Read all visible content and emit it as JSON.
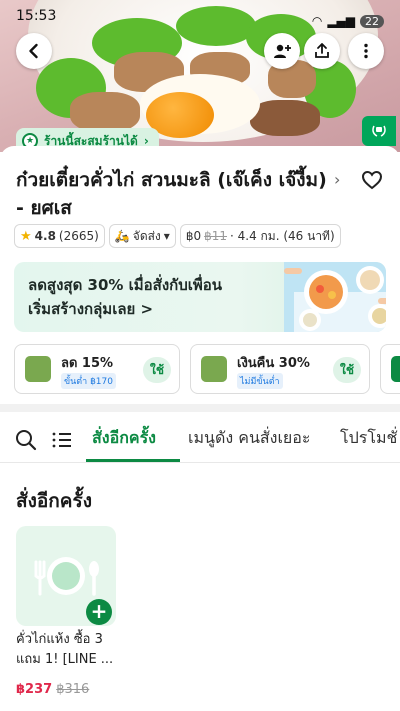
{
  "status_bar": {
    "time": "15:53",
    "battery": "22"
  },
  "hero": {
    "collect_label": "ร้านนี้สะสมร้านได้",
    "collect_chevron": "›"
  },
  "restaurant": {
    "name": "ก๋วยเตี๋ยวคั่วไก่ สวนมะลิ (เจ๊เค็ง เจ๊งี้ม) - ยศเส",
    "rating": "4.8",
    "review_count": "(2665)",
    "delivery_mode": "จัดส่ง",
    "delivery_fee": "฿0",
    "delivery_fee_original": "฿11",
    "distance_time": "· 4.4 กม. (46 นาที)"
  },
  "promo_banner": {
    "line1": "ลดสูงสุด 30% เมื่อสั่งกับเพื่อน",
    "line2": "เริ่มสร้างกลุ่มเลย >"
  },
  "coupons": [
    {
      "title": "ลด 15%",
      "sub": "ขั้นต่ำ ฿170",
      "action": "ใช้"
    },
    {
      "title": "เงินคืน 30%",
      "sub": "ไม่มีขั้นต่ำ",
      "action": "ใช้"
    }
  ],
  "tabs": {
    "active": "สั่งอีกครั้ง",
    "t2": "เมนูดัง คนสั่งเยอะ",
    "t3": "โปรโมชั่"
  },
  "section": {
    "title": "สั่งอีกครั้ง"
  },
  "items": [
    {
      "name": "คั่วไก่แห้ง ซื้อ 3 แถม 1! [LINE ...",
      "price": "฿237",
      "price_original": "฿316",
      "add_label": "+"
    }
  ],
  "colors": {
    "brand_green": "#0c8a43",
    "price_red": "#e0284b"
  }
}
